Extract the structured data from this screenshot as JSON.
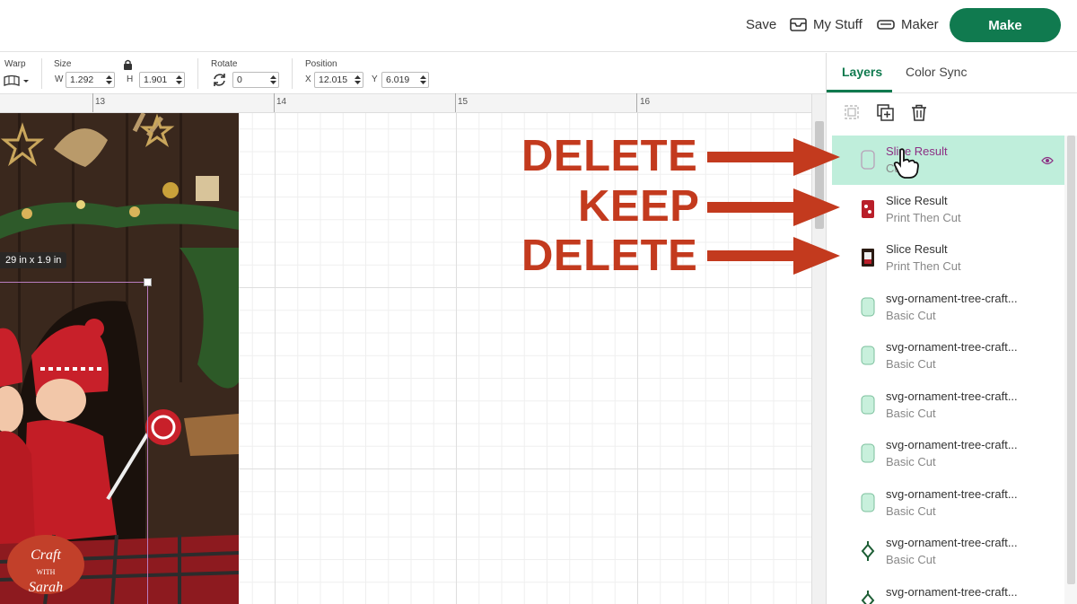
{
  "header": {
    "save_label": "Save",
    "mystuff_label": "My Stuff",
    "maker_label": "Maker",
    "make_label": "Make"
  },
  "toolbar": {
    "warp_label": "Warp",
    "size_label": "Size",
    "w_label": "W",
    "w_value": "1.292",
    "h_label": "H",
    "h_value": "1.901",
    "rotate_label": "Rotate",
    "rotate_value": "0",
    "position_label": "Position",
    "x_label": "X",
    "x_value": "12.015",
    "y_label": "Y",
    "y_value": "6.019"
  },
  "ruler": {
    "marks": [
      "13",
      "14",
      "15",
      "16"
    ]
  },
  "canvas": {
    "dimension_label": "29  in x 1.9  in",
    "watermark_line1": "Craft",
    "watermark_line2": "WITH",
    "watermark_line3": "Sarah"
  },
  "panel": {
    "tabs": [
      {
        "label": "Layers",
        "active": true
      },
      {
        "label": "Color Sync",
        "active": false
      }
    ],
    "layers": [
      {
        "name": "Slice Result",
        "type": "Cut",
        "selected": true,
        "thumb": "outline"
      },
      {
        "name": "Slice Result",
        "type": "Print Then Cut",
        "selected": false,
        "thumb": "red-photo"
      },
      {
        "name": "Slice Result",
        "type": "Print Then Cut",
        "selected": false,
        "thumb": "dark-photo"
      },
      {
        "name": "svg-ornament-tree-craft...",
        "type": "Basic Cut",
        "selected": false,
        "thumb": "mint"
      },
      {
        "name": "svg-ornament-tree-craft...",
        "type": "Basic Cut",
        "selected": false,
        "thumb": "mint"
      },
      {
        "name": "svg-ornament-tree-craft...",
        "type": "Basic Cut",
        "selected": false,
        "thumb": "mint"
      },
      {
        "name": "svg-ornament-tree-craft...",
        "type": "Basic Cut",
        "selected": false,
        "thumb": "mint"
      },
      {
        "name": "svg-ornament-tree-craft...",
        "type": "Basic Cut",
        "selected": false,
        "thumb": "mint"
      },
      {
        "name": "svg-ornament-tree-craft...",
        "type": "Basic Cut",
        "selected": false,
        "thumb": "ornament"
      },
      {
        "name": "svg-ornament-tree-craft...",
        "type": "",
        "selected": false,
        "thumb": "ornament"
      }
    ]
  },
  "annotations": [
    {
      "text": "DELETE"
    },
    {
      "text": "KEEP"
    },
    {
      "text": "DELETE"
    }
  ],
  "colors": {
    "accent": "#107a4f",
    "selected_row": "#bfeedb",
    "annotation": "#c33a1e"
  }
}
